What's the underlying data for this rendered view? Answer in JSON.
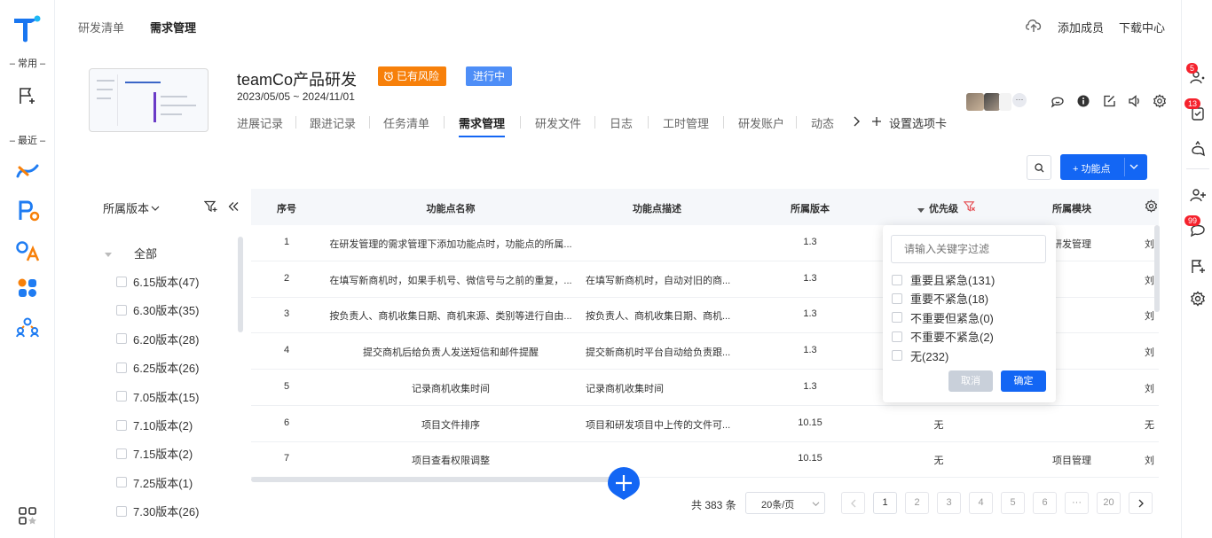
{
  "leftbar": {
    "frequent_label": "– 常用 –",
    "recent_label": "– 最近 –"
  },
  "topnav": {
    "items": [
      "研发清单",
      "需求管理"
    ],
    "right_actions": [
      "添加成员",
      "下载中心"
    ]
  },
  "project": {
    "name": "teamCo产品研发",
    "risk_badge": "已有风险",
    "status_badge": "进行中",
    "dates": "2023/05/05 ~ 2024/11/01",
    "avatar_more": "···"
  },
  "tabs": [
    "进展记录",
    "跟进记录",
    "任务清单",
    "需求管理",
    "研发文件",
    "日志",
    "工时管理",
    "研发账户",
    "动态"
  ],
  "tabs_settings": "设置选项卡",
  "toolbar": {
    "add_button": "+ 功能点"
  },
  "version_panel": {
    "title": "所属版本",
    "items": [
      {
        "label": "全部"
      },
      {
        "label": "6.15版本(47)"
      },
      {
        "label": "6.30版本(35)"
      },
      {
        "label": "6.20版本(28)"
      },
      {
        "label": "6.25版本(26)"
      },
      {
        "label": "7.05版本(15)"
      },
      {
        "label": "7.10版本(2)"
      },
      {
        "label": "7.15版本(2)"
      },
      {
        "label": "7.25版本(1)"
      },
      {
        "label": "7.30版本(26)"
      }
    ]
  },
  "table": {
    "headers": [
      "序号",
      "功能点名称",
      "功能点描述",
      "所属版本",
      "优先级",
      "所属模块"
    ],
    "rows": [
      {
        "no": "1",
        "name": "在研发管理的需求管理下添加功能点时，功能点的所属...",
        "desc": "",
        "version": "1.3",
        "priority": "",
        "module": "研发管理",
        "owner": "刘"
      },
      {
        "no": "2",
        "name": "在填写新商机时，如果手机号、微信号与之前的重复，...",
        "desc": "在填写新商机时，自动对旧的商...",
        "version": "1.3",
        "priority": "",
        "module": "",
        "owner": "刘"
      },
      {
        "no": "3",
        "name": "按负责人、商机收集日期、商机来源、类别等进行自由...",
        "desc": "按负责人、商机收集日期、商机...",
        "version": "1.3",
        "priority": "",
        "module": "",
        "owner": "刘"
      },
      {
        "no": "4",
        "name": "提交商机后给负责人发送短信和邮件提醒",
        "desc": "提交新商机时平台自动给负责跟...",
        "version": "1.3",
        "priority": "",
        "module": "",
        "owner": "刘"
      },
      {
        "no": "5",
        "name": "记录商机收集时间",
        "desc": "记录商机收集时间",
        "version": "1.3",
        "priority": "",
        "module": "",
        "owner": "刘"
      },
      {
        "no": "6",
        "name": "项目文件排序",
        "desc": "项目和研发项目中上传的文件可...",
        "version": "10.15",
        "priority": "无",
        "module": "",
        "owner": "无"
      },
      {
        "no": "7",
        "name": "项目查看权限调整",
        "desc": "",
        "version": "10.15",
        "priority": "无",
        "module": "项目管理",
        "owner": "刘"
      }
    ]
  },
  "filter_popup": {
    "placeholder": "请输入关键字过滤",
    "options": [
      "重要且紧急(131)",
      "重要不紧急(18)",
      "不重要但紧急(0)",
      "不重要不紧急(2)",
      "无(232)"
    ],
    "cancel": "取消",
    "confirm": "确定"
  },
  "pagination": {
    "total": "共 383 条",
    "page_size": "20条/页",
    "pages": [
      "1",
      "2",
      "3",
      "4",
      "5",
      "6",
      "···",
      "20"
    ]
  },
  "rightbar": {
    "badges": [
      "5",
      "13",
      "99"
    ]
  },
  "colors": {
    "primary": "#1366f4",
    "risk": "#f7800a",
    "status": "#4e8ef7"
  }
}
